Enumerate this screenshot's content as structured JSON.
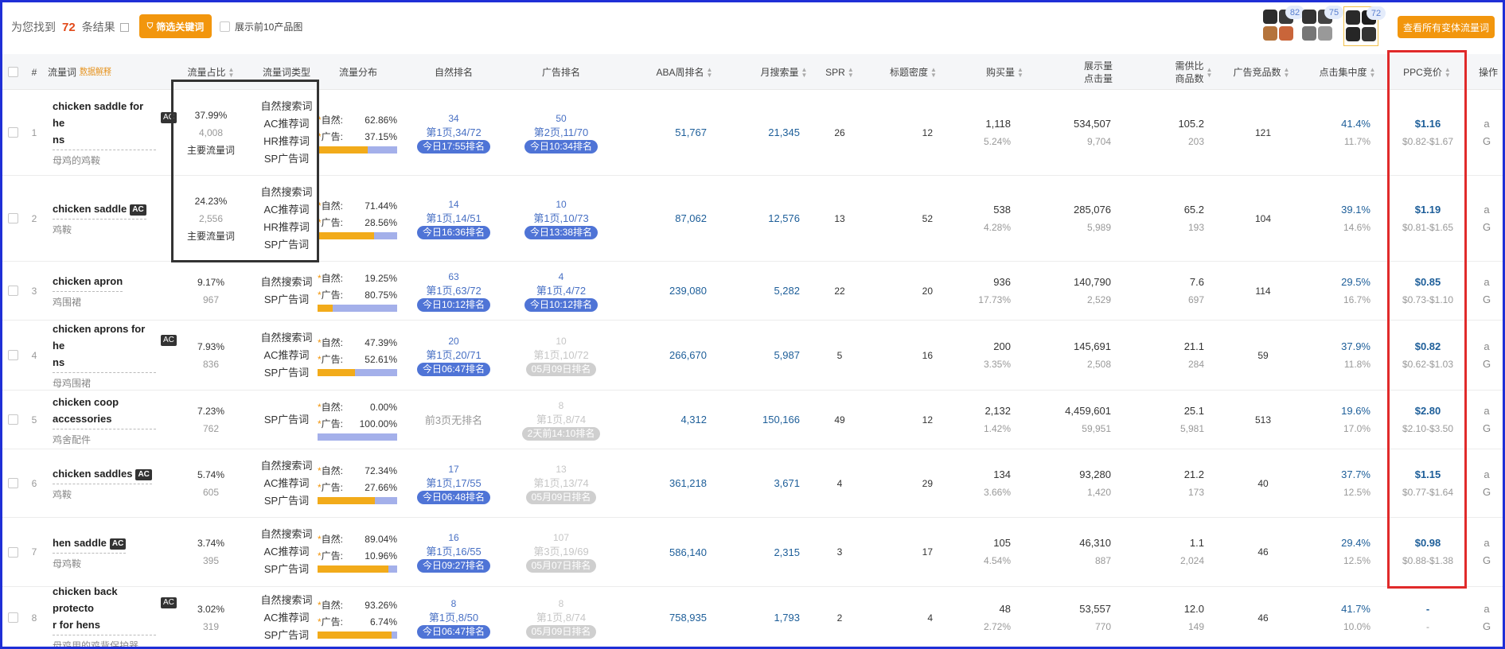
{
  "toolbar": {
    "result_prefix": "为您找到",
    "result_count": "72",
    "result_suffix": "条结果",
    "filter_button": "筛选关键词",
    "top10_label": "展示前10产品图",
    "variant_counts": [
      "82",
      "75",
      "72"
    ],
    "variants_button": "查看所有变体流量词"
  },
  "columns": {
    "index": "#",
    "keyword": "流量词",
    "keyword_note": "数据解释",
    "share": "流量占比",
    "type": "流量词类型",
    "dist": "流量分布",
    "natural_rank": "自然排名",
    "ad_rank": "广告排名",
    "aba": "ABA周排名",
    "monthly": "月搜索量",
    "spr": "SPR",
    "title_density": "标题密度",
    "purchase": "购买量",
    "impressions": "展示量",
    "clicks": "点击量",
    "supply_demand": "需供比",
    "products": "商品数",
    "ad_products": "广告竞品数",
    "click_conc": "点击集中度",
    "ppc": "PPC竞价",
    "ops": "操作"
  },
  "labels": {
    "natural": "自然:",
    "ad": "广告:",
    "main_kw": "主要流量词",
    "no_rank": "前3页无排名"
  },
  "rows": [
    {
      "idx": "1",
      "kw": "chicken saddle for he",
      "kw2": "ns",
      "ac": "AC",
      "cn": "母鸡的鸡鞍",
      "share": "37.99%",
      "share2": "4,008",
      "main": "主要流量词",
      "types": [
        "自然搜索词",
        "AC推荐词",
        "HR推荐词",
        "SP广告词"
      ],
      "nat": "62.86%",
      "adp": "37.15%",
      "nat_frac": 0.6286,
      "nr_num": "34",
      "nr_page": "第1页,34/72",
      "nr_pill": "今日17:55排名",
      "nr_muted": false,
      "ar_num": "50",
      "ar_page": "第2页,11/70",
      "ar_pill": "今日10:34排名",
      "ar_muted": false,
      "aba": "51,767",
      "monthly": "21,345",
      "spr": "26",
      "td": "12",
      "buy": "1,118",
      "buy2": "5.24%",
      "imp": "534,507",
      "clk": "9,704",
      "sd": "105.2",
      "prod": "203",
      "adprod": "121",
      "cc": "41.4%",
      "cc2": "11.7%",
      "ppc": "$1.16",
      "ppc2": "$0.82-$1.67"
    },
    {
      "idx": "2",
      "kw": "chicken saddle",
      "kw2": "",
      "ac": "AC",
      "cn": "鸡鞍",
      "share": "24.23%",
      "share2": "2,556",
      "main": "主要流量词",
      "types": [
        "自然搜索词",
        "AC推荐词",
        "HR推荐词",
        "SP广告词"
      ],
      "nat": "71.44%",
      "adp": "28.56%",
      "nat_frac": 0.7144,
      "nr_num": "14",
      "nr_page": "第1页,14/51",
      "nr_pill": "今日16:36排名",
      "nr_muted": false,
      "ar_num": "10",
      "ar_page": "第1页,10/73",
      "ar_pill": "今日13:38排名",
      "ar_muted": false,
      "aba": "87,062",
      "monthly": "12,576",
      "spr": "13",
      "td": "52",
      "buy": "538",
      "buy2": "4.28%",
      "imp": "285,076",
      "clk": "5,989",
      "sd": "65.2",
      "prod": "193",
      "adprod": "104",
      "cc": "39.1%",
      "cc2": "14.6%",
      "ppc": "$1.19",
      "ppc2": "$0.81-$1.65"
    },
    {
      "idx": "3",
      "kw": "chicken apron",
      "kw2": "",
      "ac": "",
      "cn": "鸡围裙",
      "share": "9.17%",
      "share2": "967",
      "main": "",
      "types": [
        "自然搜索词",
        "SP广告词"
      ],
      "nat": "19.25%",
      "adp": "80.75%",
      "nat_frac": 0.1925,
      "nr_num": "63",
      "nr_page": "第1页,63/72",
      "nr_pill": "今日10:12排名",
      "nr_muted": false,
      "ar_num": "4",
      "ar_page": "第1页,4/72",
      "ar_pill": "今日10:12排名",
      "ar_muted": false,
      "aba": "239,080",
      "monthly": "5,282",
      "spr": "22",
      "td": "20",
      "buy": "936",
      "buy2": "17.73%",
      "imp": "140,790",
      "clk": "2,529",
      "sd": "7.6",
      "prod": "697",
      "adprod": "114",
      "cc": "29.5%",
      "cc2": "16.7%",
      "ppc": "$0.85",
      "ppc2": "$0.73-$1.10"
    },
    {
      "idx": "4",
      "kw": "chicken aprons for he",
      "kw2": "ns",
      "ac": "AC",
      "cn": "母鸡围裙",
      "share": "7.93%",
      "share2": "836",
      "main": "",
      "types": [
        "自然搜索词",
        "AC推荐词",
        "SP广告词"
      ],
      "nat": "47.39%",
      "adp": "52.61%",
      "nat_frac": 0.4739,
      "nr_num": "20",
      "nr_page": "第1页,20/71",
      "nr_pill": "今日06:47排名",
      "nr_muted": false,
      "ar_num": "10",
      "ar_page": "第1页,10/72",
      "ar_pill": "05月09日排名",
      "ar_muted": true,
      "aba": "266,670",
      "monthly": "5,987",
      "spr": "5",
      "td": "16",
      "buy": "200",
      "buy2": "3.35%",
      "imp": "145,691",
      "clk": "2,508",
      "sd": "21.1",
      "prod": "284",
      "adprod": "59",
      "cc": "37.9%",
      "cc2": "11.8%",
      "ppc": "$0.82",
      "ppc2": "$0.62-$1.03"
    },
    {
      "idx": "5",
      "kw": "chicken coop accessories",
      "kw2": "",
      "ac": "",
      "cn": "鸡舍配件",
      "share": "7.23%",
      "share2": "762",
      "main": "",
      "types": [
        "SP广告词"
      ],
      "nat": "0.00%",
      "adp": "100.00%",
      "nat_frac": 0.0,
      "nr_num": "",
      "nr_page": "",
      "nr_pill": "",
      "nr_none": "前3页无排名",
      "nr_muted": false,
      "ar_num": "8",
      "ar_page": "第1页,8/74",
      "ar_pill": "2天前14:10排名",
      "ar_muted": true,
      "aba": "4,312",
      "monthly": "150,166",
      "spr": "49",
      "td": "12",
      "buy": "2,132",
      "buy2": "1.42%",
      "imp": "4,459,601",
      "clk": "59,951",
      "sd": "25.1",
      "prod": "5,981",
      "adprod": "513",
      "cc": "19.6%",
      "cc2": "17.0%",
      "ppc": "$2.80",
      "ppc2": "$2.10-$3.50"
    },
    {
      "idx": "6",
      "kw": "chicken saddles",
      "kw2": "",
      "ac": "AC",
      "cn": "鸡鞍",
      "share": "5.74%",
      "share2": "605",
      "main": "",
      "types": [
        "自然搜索词",
        "AC推荐词",
        "SP广告词"
      ],
      "nat": "72.34%",
      "adp": "27.66%",
      "nat_frac": 0.7234,
      "nr_num": "17",
      "nr_page": "第1页,17/55",
      "nr_pill": "今日06:48排名",
      "nr_muted": false,
      "ar_num": "13",
      "ar_page": "第1页,13/74",
      "ar_pill": "05月09日排名",
      "ar_muted": true,
      "aba": "361,218",
      "monthly": "3,671",
      "spr": "4",
      "td": "29",
      "buy": "134",
      "buy2": "3.66%",
      "imp": "93,280",
      "clk": "1,420",
      "sd": "21.2",
      "prod": "173",
      "adprod": "40",
      "cc": "37.7%",
      "cc2": "12.5%",
      "ppc": "$1.15",
      "ppc2": "$0.77-$1.64"
    },
    {
      "idx": "7",
      "kw": "hen saddle",
      "kw2": "",
      "ac": "AC",
      "cn": "母鸡鞍",
      "share": "3.74%",
      "share2": "395",
      "main": "",
      "types": [
        "自然搜索词",
        "AC推荐词",
        "SP广告词"
      ],
      "nat": "89.04%",
      "adp": "10.96%",
      "nat_frac": 0.8904,
      "nr_num": "16",
      "nr_page": "第1页,16/55",
      "nr_pill": "今日09:27排名",
      "nr_muted": false,
      "ar_num": "107",
      "ar_page": "第3页,19/69",
      "ar_pill": "05月07日排名",
      "ar_muted": true,
      "aba": "586,140",
      "monthly": "2,315",
      "spr": "3",
      "td": "17",
      "buy": "105",
      "buy2": "4.54%",
      "imp": "46,310",
      "clk": "887",
      "sd": "1.1",
      "prod": "2,024",
      "adprod": "46",
      "cc": "29.4%",
      "cc2": "12.5%",
      "ppc": "$0.98",
      "ppc2": "$0.88-$1.38"
    },
    {
      "idx": "8",
      "kw": "chicken back protecto",
      "kw2": "r for hens",
      "ac": "AC",
      "cn": "母鸡用的鸡背保护器",
      "share": "3.02%",
      "share2": "319",
      "main": "",
      "types": [
        "自然搜索词",
        "AC推荐词",
        "SP广告词"
      ],
      "nat": "93.26%",
      "adp": "6.74%",
      "nat_frac": 0.9326,
      "nr_num": "8",
      "nr_page": "第1页,8/50",
      "nr_pill": "今日06:47排名",
      "nr_muted": false,
      "ar_num": "8",
      "ar_page": "第1页,8/74",
      "ar_pill": "05月09日排名",
      "ar_muted": true,
      "aba": "758,935",
      "monthly": "1,793",
      "spr": "2",
      "td": "4",
      "buy": "48",
      "buy2": "2.72%",
      "imp": "53,557",
      "clk": "770",
      "sd": "12.0",
      "prod": "149",
      "adprod": "46",
      "cc": "41.7%",
      "cc2": "10.0%",
      "ppc": "-",
      "ppc2": "-"
    }
  ],
  "ops_icons": [
    "amazon-icon",
    "google-icon"
  ],
  "ops_glyphs": {
    "amazon": "a",
    "google": "G"
  },
  "colors": {
    "accent": "#f2960d",
    "ad_bar": "#a4b0ea",
    "natural_bar": "#f2ab1a",
    "pill": "#4f74d6",
    "link_dark": "#1d5e99",
    "annotation_red": "#e02a2a",
    "frame_blue": "#1f2fd6"
  }
}
